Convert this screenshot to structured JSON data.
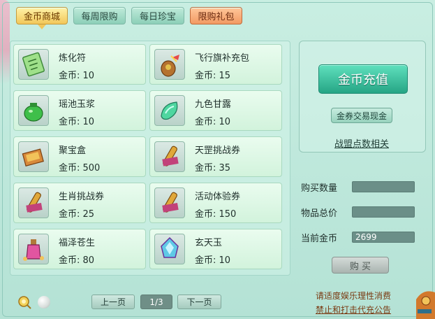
{
  "tabs": [
    {
      "label": "金币商城",
      "active": true
    },
    {
      "label": "每周限购",
      "active": false
    },
    {
      "label": "每日珍宝",
      "active": false
    },
    {
      "label": "限购礼包",
      "active": false
    }
  ],
  "items": [
    {
      "name": "炼化符",
      "price": "金币: 10",
      "icon": "talisman-icon"
    },
    {
      "name": "飞行旗补充包",
      "price": "金币: 15",
      "icon": "flag-pack-icon"
    },
    {
      "name": "瑶池玉浆",
      "price": "金币: 10",
      "icon": "jade-nectar-icon"
    },
    {
      "name": "九色甘露",
      "price": "金币: 10",
      "icon": "dew-icon"
    },
    {
      "name": "聚宝盒",
      "price": "金币: 500",
      "icon": "treasure-box-icon"
    },
    {
      "name": "天罡挑战券",
      "price": "金币: 35",
      "icon": "scroll-icon"
    },
    {
      "name": "生肖挑战券",
      "price": "金币: 25",
      "icon": "scroll-icon"
    },
    {
      "name": "活动体验券",
      "price": "金币: 150",
      "icon": "scroll-icon"
    },
    {
      "name": "福泽苍生",
      "price": "金币: 80",
      "icon": "blessing-bottle-icon"
    },
    {
      "name": "玄天玉",
      "price": "金币: 10",
      "icon": "jade-gem-icon"
    }
  ],
  "right": {
    "recharge_label": "金币充值",
    "exchange_label": "金券交易现金",
    "alliance_label": "战盟点数相关",
    "quantity_label": "购买数量",
    "quantity_value": "",
    "total_label": "物品总价",
    "total_value": "",
    "current_label": "当前金币",
    "current_value": "2699",
    "buy_label": "购 买"
  },
  "pagination": {
    "prev_label": "上一页",
    "indicator": "1/3",
    "next_label": "下一页"
  },
  "notice": {
    "line1": "请适度娱乐理性消费",
    "line2": "禁止和打击代充公告"
  },
  "colors": {
    "accent": "#26a585",
    "active_tab": "#f2c75a",
    "limited_tab": "#f29a63",
    "notice_text": "#7a3a12"
  }
}
